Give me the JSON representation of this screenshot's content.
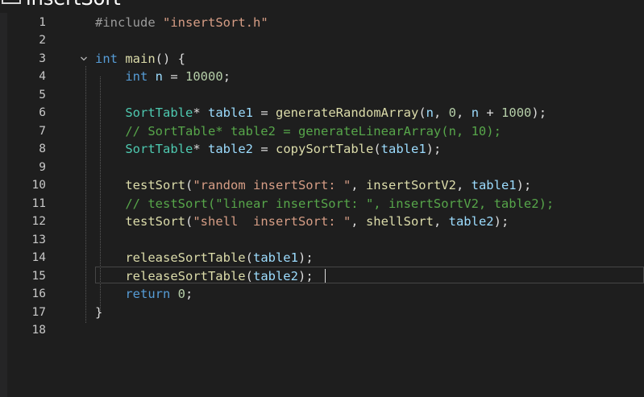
{
  "window": {
    "title": "insertSort"
  },
  "editor": {
    "line_numbers": [
      "1",
      "2",
      "3",
      "4",
      "5",
      "6",
      "7",
      "8",
      "9",
      "10",
      "11",
      "12",
      "13",
      "14",
      "15",
      "16",
      "17",
      "18"
    ],
    "current_line": 15,
    "lines": [
      [
        {
          "t": "#include ",
          "c": "pp"
        },
        {
          "t": "\"insertSort.h\"",
          "c": "str"
        }
      ],
      [],
      [
        {
          "t": "int",
          "c": "kw"
        },
        {
          "t": " ",
          "c": "pn"
        },
        {
          "t": "main",
          "c": "fn"
        },
        {
          "t": "() {",
          "c": "pn"
        }
      ],
      [
        {
          "t": "    ",
          "c": "pn"
        },
        {
          "t": "int",
          "c": "kw"
        },
        {
          "t": " ",
          "c": "pn"
        },
        {
          "t": "n",
          "c": "var"
        },
        {
          "t": " = ",
          "c": "pn"
        },
        {
          "t": "10000",
          "c": "num"
        },
        {
          "t": ";",
          "c": "pn"
        }
      ],
      [],
      [
        {
          "t": "    ",
          "c": "pn"
        },
        {
          "t": "SortTable",
          "c": "type"
        },
        {
          "t": "* ",
          "c": "pn"
        },
        {
          "t": "table1",
          "c": "var"
        },
        {
          "t": " = ",
          "c": "pn"
        },
        {
          "t": "generateRandomArray",
          "c": "fn"
        },
        {
          "t": "(",
          "c": "pn"
        },
        {
          "t": "n",
          "c": "var"
        },
        {
          "t": ", ",
          "c": "pn"
        },
        {
          "t": "0",
          "c": "num"
        },
        {
          "t": ", ",
          "c": "pn"
        },
        {
          "t": "n",
          "c": "var"
        },
        {
          "t": " + ",
          "c": "pn"
        },
        {
          "t": "1000",
          "c": "num"
        },
        {
          "t": ");",
          "c": "pn"
        }
      ],
      [
        {
          "t": "    ",
          "c": "pn"
        },
        {
          "t": "// SortTable* table2 = generateLinearArray(n, 10);",
          "c": "cm"
        }
      ],
      [
        {
          "t": "    ",
          "c": "pn"
        },
        {
          "t": "SortTable",
          "c": "type"
        },
        {
          "t": "* ",
          "c": "pn"
        },
        {
          "t": "table2",
          "c": "var"
        },
        {
          "t": " = ",
          "c": "pn"
        },
        {
          "t": "copySortTable",
          "c": "fn"
        },
        {
          "t": "(",
          "c": "pn"
        },
        {
          "t": "table1",
          "c": "var"
        },
        {
          "t": ");",
          "c": "pn"
        }
      ],
      [],
      [
        {
          "t": "    ",
          "c": "pn"
        },
        {
          "t": "testSort",
          "c": "fn"
        },
        {
          "t": "(",
          "c": "pn"
        },
        {
          "t": "\"random insertSort: \"",
          "c": "str"
        },
        {
          "t": ", ",
          "c": "pn"
        },
        {
          "t": "insertSortV2",
          "c": "fn"
        },
        {
          "t": ", ",
          "c": "pn"
        },
        {
          "t": "table1",
          "c": "var"
        },
        {
          "t": ");",
          "c": "pn"
        }
      ],
      [
        {
          "t": "    ",
          "c": "pn"
        },
        {
          "t": "// testSort(\"linear insertSort: \", insertSortV2, table2);",
          "c": "cm"
        }
      ],
      [
        {
          "t": "    ",
          "c": "pn"
        },
        {
          "t": "testSort",
          "c": "fn"
        },
        {
          "t": "(",
          "c": "pn"
        },
        {
          "t": "\"shell  insertSort: \"",
          "c": "str"
        },
        {
          "t": ", ",
          "c": "pn"
        },
        {
          "t": "shellSort",
          "c": "fn"
        },
        {
          "t": ", ",
          "c": "pn"
        },
        {
          "t": "table2",
          "c": "var"
        },
        {
          "t": ");",
          "c": "pn"
        }
      ],
      [],
      [
        {
          "t": "    ",
          "c": "pn"
        },
        {
          "t": "releaseSortTable",
          "c": "fn"
        },
        {
          "t": "(",
          "c": "pn"
        },
        {
          "t": "table1",
          "c": "var"
        },
        {
          "t": ");",
          "c": "pn"
        }
      ],
      [
        {
          "t": "    ",
          "c": "pn"
        },
        {
          "t": "releaseSortTable",
          "c": "fn"
        },
        {
          "t": "(",
          "c": "pn"
        },
        {
          "t": "table2",
          "c": "var"
        },
        {
          "t": ");",
          "c": "pn"
        }
      ],
      [
        {
          "t": "    ",
          "c": "pn"
        },
        {
          "t": "return",
          "c": "kw"
        },
        {
          "t": " ",
          "c": "pn"
        },
        {
          "t": "0",
          "c": "num"
        },
        {
          "t": ";",
          "c": "pn"
        }
      ],
      [
        {
          "t": "}",
          "c": "pn"
        }
      ],
      []
    ]
  }
}
